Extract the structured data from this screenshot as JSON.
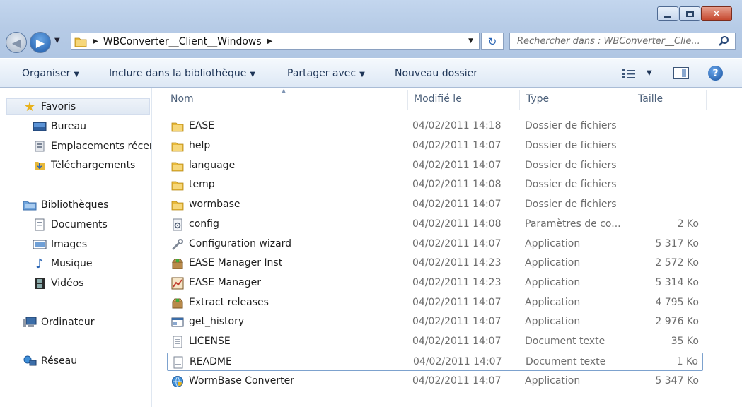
{
  "window": {
    "minimize_icon": "minimize-icon",
    "maximize_icon": "maximize-icon",
    "close_icon": "close-icon"
  },
  "address": {
    "path": "WBConverter__Client__Windows",
    "search_placeholder": "Rechercher dans : WBConverter__Clie..."
  },
  "toolbar": {
    "organize": "Organiser",
    "include_library": "Inclure dans la bibliothèque",
    "share": "Partager avec",
    "new_folder": "Nouveau dossier"
  },
  "nav": {
    "favorites": "Favoris",
    "desktop": "Bureau",
    "recent": "Emplacements récents",
    "downloads": "Téléchargements",
    "libraries": "Bibliothèques",
    "documents": "Documents",
    "images": "Images",
    "music": "Musique",
    "videos": "Vidéos",
    "computer": "Ordinateur",
    "network": "Réseau"
  },
  "columns": {
    "name": "Nom",
    "modified": "Modifié le",
    "type": "Type",
    "size": "Taille"
  },
  "files": [
    {
      "name": "EASE",
      "modified": "04/02/2011 14:18",
      "type": "Dossier de fichiers",
      "size": "",
      "icon": "folder-icon"
    },
    {
      "name": "help",
      "modified": "04/02/2011 14:07",
      "type": "Dossier de fichiers",
      "size": "",
      "icon": "folder-icon"
    },
    {
      "name": "language",
      "modified": "04/02/2011 14:07",
      "type": "Dossier de fichiers",
      "size": "",
      "icon": "folder-icon"
    },
    {
      "name": "temp",
      "modified": "04/02/2011 14:08",
      "type": "Dossier de fichiers",
      "size": "",
      "icon": "folder-icon"
    },
    {
      "name": "wormbase",
      "modified": "04/02/2011 14:07",
      "type": "Dossier de fichiers",
      "size": "",
      "icon": "folder-icon"
    },
    {
      "name": "config",
      "modified": "04/02/2011 14:08",
      "type": "Paramètres de co...",
      "size": "2 Ko",
      "icon": "settings-file-icon"
    },
    {
      "name": "Configuration wizard",
      "modified": "04/02/2011 14:07",
      "type": "Application",
      "size": "5 317 Ko",
      "icon": "wrench-icon"
    },
    {
      "name": "EASE Manager Inst",
      "modified": "04/02/2011 14:23",
      "type": "Application",
      "size": "2 572 Ko",
      "icon": "installer-box-icon"
    },
    {
      "name": "EASE Manager",
      "modified": "04/02/2011 14:23",
      "type": "Application",
      "size": "5 314 Ko",
      "icon": "chart-app-icon"
    },
    {
      "name": "Extract releases",
      "modified": "04/02/2011 14:07",
      "type": "Application",
      "size": "4 795 Ko",
      "icon": "installer-box-icon"
    },
    {
      "name": "get_history",
      "modified": "04/02/2011 14:07",
      "type": "Application",
      "size": "2 976 Ko",
      "icon": "window-app-icon"
    },
    {
      "name": "LICENSE",
      "modified": "04/02/2011 14:07",
      "type": "Document texte",
      "size": "35 Ko",
      "icon": "text-file-icon"
    },
    {
      "name": "README",
      "modified": "04/02/2011 14:07",
      "type": "Document texte",
      "size": "1 Ko",
      "icon": "text-file-icon"
    },
    {
      "name": "WormBase Converter",
      "modified": "04/02/2011 14:07",
      "type": "Application",
      "size": "5 347 Ko",
      "icon": "globe-app-icon"
    }
  ],
  "focused_row": 12,
  "colors": {
    "folder": "#e8b93a",
    "accent": "#2b65b4",
    "focus_border": "#7da2ce"
  }
}
